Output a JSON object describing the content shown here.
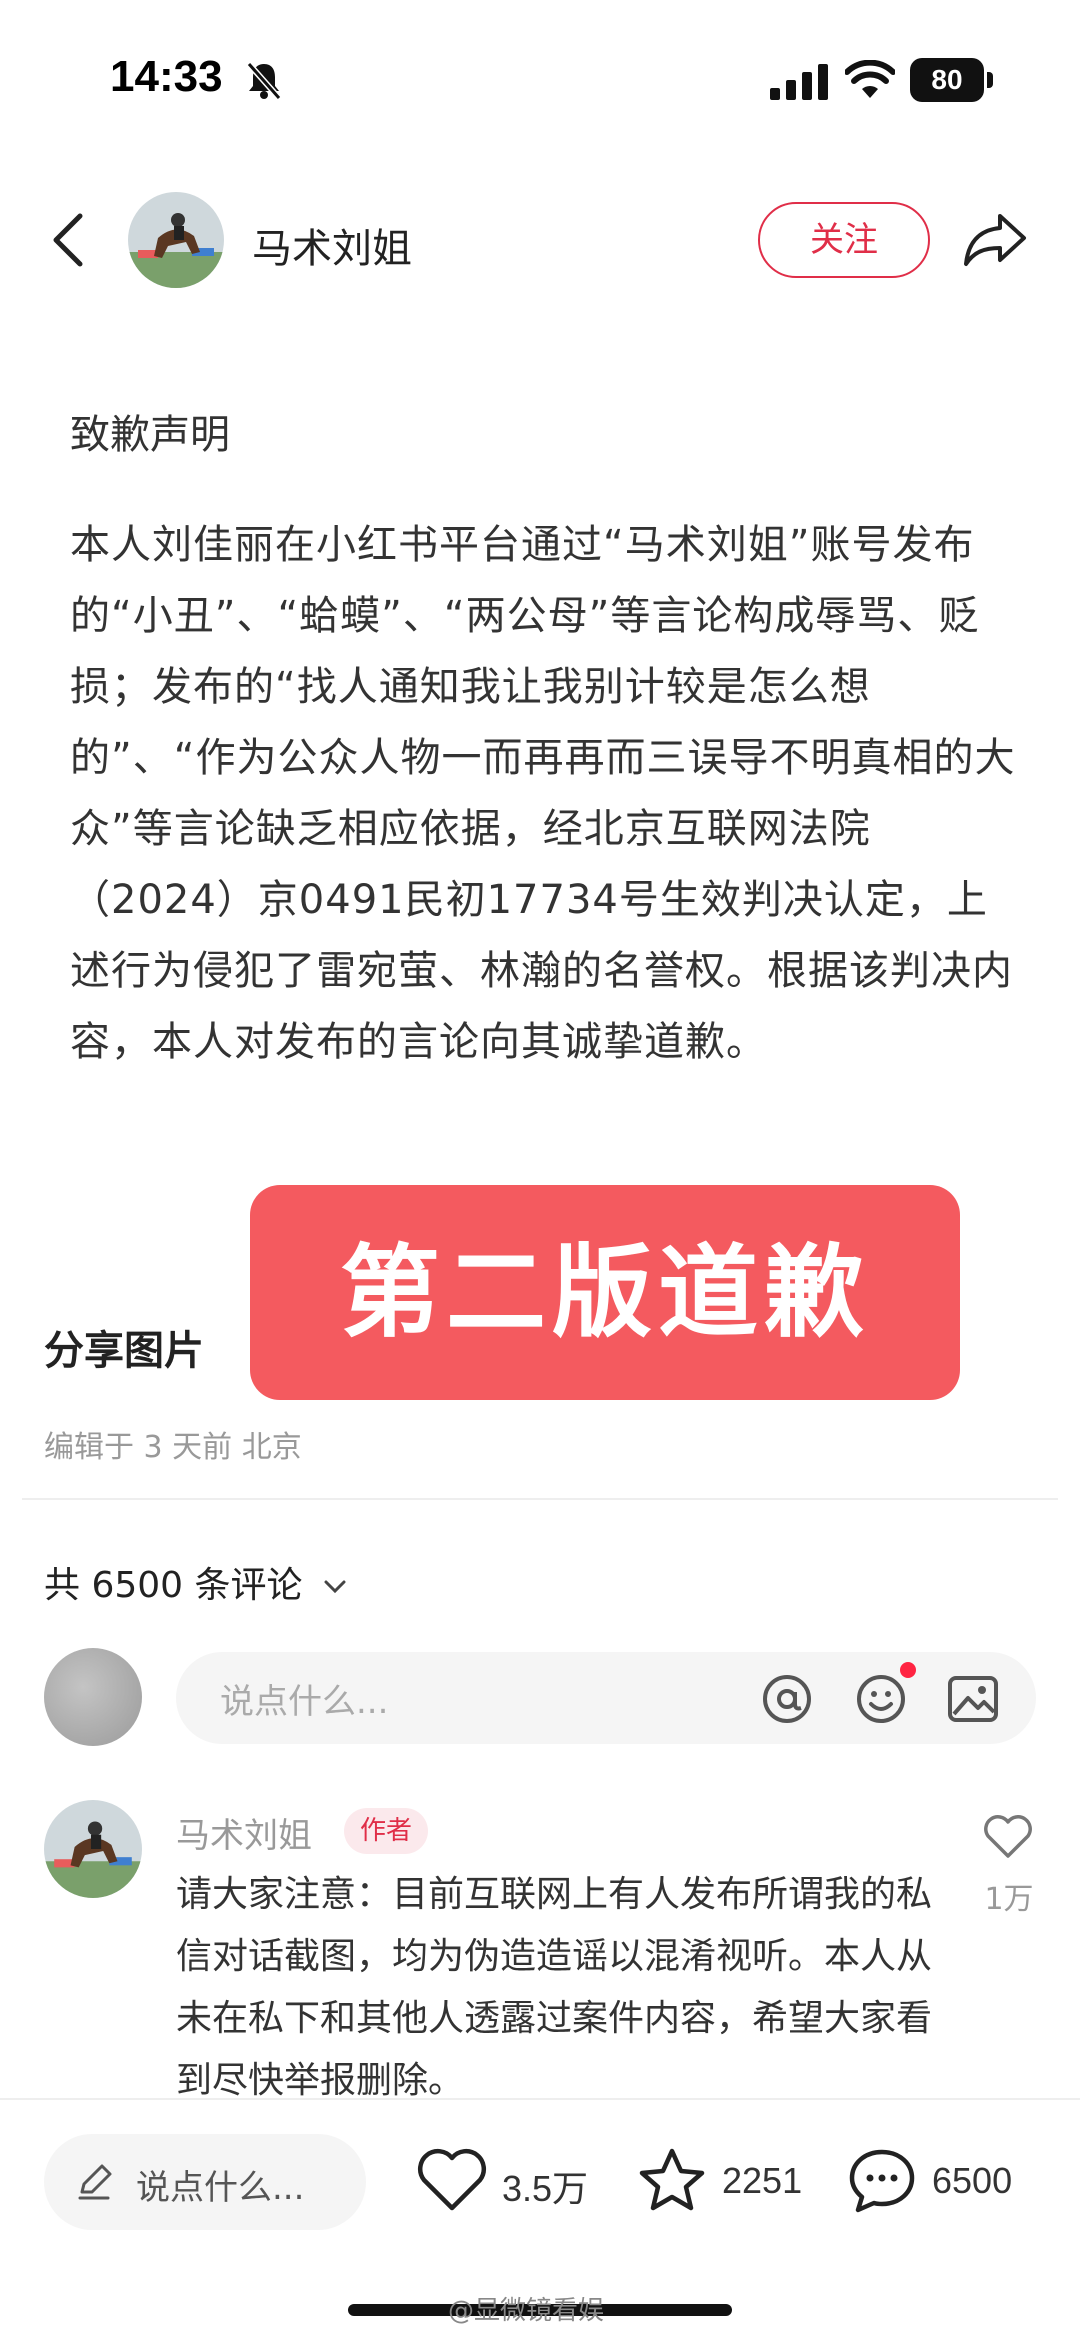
{
  "status_bar": {
    "time": "14:33",
    "battery": "80"
  },
  "header": {
    "author_name": "马术刘姐",
    "follow_label": "关注"
  },
  "note": {
    "title": "致歉声明",
    "body": "本人刘佳丽在小红书平台通过“马术刘姐”账号发布的“小丑”、“蛤蟆”、“两公母”等言论构成辱骂、贬损；发布的“找人通知我让我别计较是怎么想的”、“作为公众人物一而再再而三误导不明真相的大众”等言论缺乏相应依据，经北京互联网法院（2024）京0491民初17734号生效判决认定，上述行为侵犯了雷宛萤、林瀚的名誉权。根据该判决内容，本人对发布的言论向其诚挚道歉。",
    "overlay_text": "第二版道歉",
    "share_images_label": "分享图片",
    "edit_info": "编辑于 3 天前 北京"
  },
  "comments": {
    "count_label": "共 6500 条评论",
    "input_placeholder": "说点什么...",
    "items": [
      {
        "author": "马术刘姐",
        "badge": "作者",
        "text": "请大家注意：目前互联网上有人发布所谓我的私信对话截图，均为伪造造谣以混淆视听。本人从未在私下和其他人透露过案件内容，希望大家看到尽快举报删除。",
        "likes": "1万"
      }
    ]
  },
  "bottom_bar": {
    "input_label": "说点什么...",
    "likes": "3.5万",
    "collects": "2251",
    "comments": "6500"
  },
  "watermark": "@显微镜看娱",
  "colors": {
    "accent": "#e02e48",
    "overlay": "#f45a5f"
  }
}
